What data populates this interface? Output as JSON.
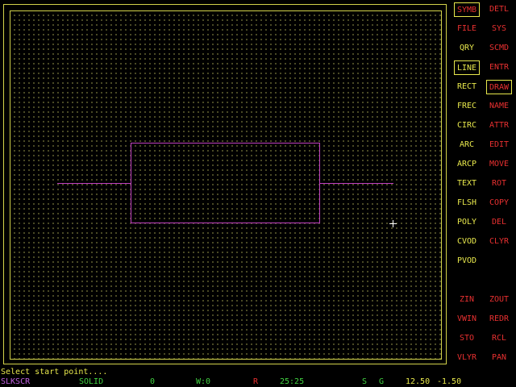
{
  "colors": {
    "menu_red": "#e83030",
    "menu_yellow": "#e8e84c",
    "shape_magenta": "#c040c0",
    "grid_dot": "#8c8c46",
    "border_yellow": "#d2d24a",
    "layer_magenta": "#c060e0",
    "status_green": "#40d040",
    "status_red": "#e83030",
    "cursor": "#ffffff"
  },
  "menu": {
    "left": {
      "symb": "SYMB",
      "file": "FILE",
      "qry": "QRY",
      "line": "LINE",
      "rect": "RECT",
      "frec": "FREC",
      "circ": "CIRC",
      "arc": "ARC",
      "arcp": "ARCP",
      "text": "TEXT",
      "flsh": "FLSH",
      "poly": "POLY",
      "cvod": "CVOD",
      "pvod": "PVOD",
      "zin": "ZIN",
      "vwin": "VWIN",
      "sto": "STO",
      "vlyr": "VLYR"
    },
    "right": {
      "detl": "DETL",
      "sys": "SYS",
      "scmd": "SCMD",
      "entr": "ENTR",
      "draw": "DRAW",
      "name": "NAME",
      "attr": "ATTR",
      "edit": "EDIT",
      "move": "MOVE",
      "rot": "ROT",
      "copy": "COPY",
      "del": "DEL",
      "clyr": "CLYR",
      "zout": "ZOUT",
      "redr": "REDR",
      "rcl": "RCL",
      "pan": "PAN"
    }
  },
  "prompt": "Select start point....",
  "status": {
    "layer": "SLKSCR",
    "line_style": "SOLID",
    "zero": "0",
    "width": "W:0",
    "r": "R",
    "grid": "25:25",
    "s": "S",
    "g": "G",
    "x": "12.50",
    "y": "-1.50"
  }
}
